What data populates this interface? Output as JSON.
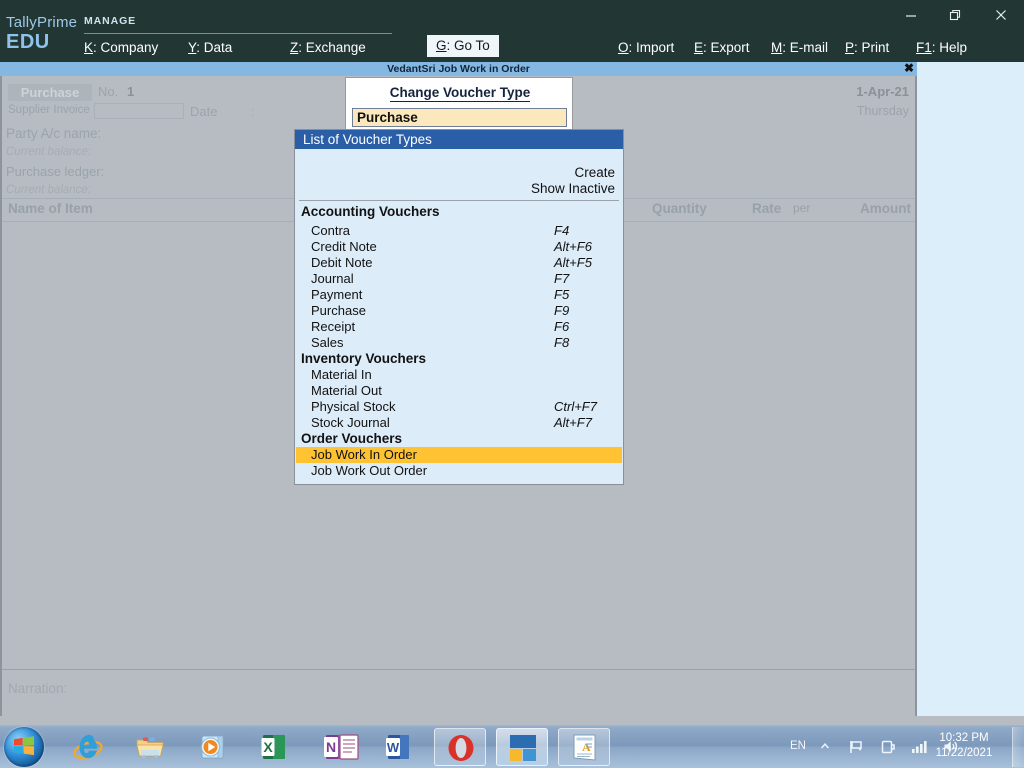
{
  "window": {
    "brand": "TallyPrime",
    "edition": "EDU",
    "minimize_label": "minimize",
    "restore_label": "restore",
    "close_label": "close"
  },
  "topbar": {
    "manage_label": "MANAGE",
    "left_menu": [
      {
        "key": "K",
        "label": "Company"
      },
      {
        "key": "Y",
        "label": "Data"
      },
      {
        "key": "Z",
        "label": "Exchange"
      }
    ],
    "goto": {
      "key": "G",
      "label": "Go To"
    },
    "right_menu": [
      {
        "key": "O",
        "label": "Import"
      },
      {
        "key": "E",
        "label": "Export"
      },
      {
        "key": "M",
        "label": "E-mail"
      },
      {
        "key": "P",
        "label": "Print"
      },
      {
        "key": "F1",
        "label": "Help"
      }
    ]
  },
  "document": {
    "title": "VedantSri Job Work in Order",
    "close_glyph": "✖"
  },
  "voucher_form": {
    "voucher_type": "Purchase",
    "no_label": "No.",
    "no_value": "1",
    "supplier_invoice_label": "Supplier Invoice No.:",
    "supplier_invoice_value": "",
    "date_label": "Date",
    "date_colon": ":",
    "party_label": "Party A/c name:",
    "current_balance_label_1": "Current balance:",
    "purchase_ledger_label": "Purchase ledger:",
    "current_balance_label_2": "Current balance:",
    "header_date": "1-Apr-21",
    "header_day": "Thursday",
    "columns": [
      {
        "label": "Name of Item",
        "align": "left"
      },
      {
        "label": "Quantity",
        "align": "right"
      },
      {
        "label": "Rate",
        "align": "right"
      },
      {
        "label": "per",
        "align": "left"
      },
      {
        "label": "Amount",
        "align": "right"
      }
    ],
    "narration_label": "Narration:"
  },
  "change_voucher_type": {
    "title": "Change Voucher Type",
    "input_value": "Purchase"
  },
  "voucher_list": {
    "header": "List of Voucher Types",
    "actions": [
      "Create",
      "Show Inactive"
    ],
    "groups": [
      {
        "name": "Accounting Vouchers",
        "items": [
          {
            "name": "Contra",
            "shortcut": "F4"
          },
          {
            "name": "Credit Note",
            "shortcut": "Alt+F6"
          },
          {
            "name": "Debit Note",
            "shortcut": "Alt+F5"
          },
          {
            "name": "Journal",
            "shortcut": "F7"
          },
          {
            "name": "Payment",
            "shortcut": "F5"
          },
          {
            "name": "Purchase",
            "shortcut": "F9"
          },
          {
            "name": "Receipt",
            "shortcut": "F6"
          },
          {
            "name": "Sales",
            "shortcut": "F8"
          }
        ]
      },
      {
        "name": "Inventory Vouchers",
        "items": [
          {
            "name": "Material In",
            "shortcut": ""
          },
          {
            "name": "Material Out",
            "shortcut": ""
          },
          {
            "name": "Physical Stock",
            "shortcut": "Ctrl+F7"
          },
          {
            "name": "Stock Journal",
            "shortcut": "Alt+F7"
          }
        ]
      },
      {
        "name": "Order Vouchers",
        "items": [
          {
            "name": "Job Work In Order",
            "shortcut": "",
            "selected": true
          },
          {
            "name": "Job Work Out Order",
            "shortcut": ""
          }
        ]
      }
    ],
    "selected_item": "Job Work In Order"
  },
  "taskbar": {
    "start_label": "Start",
    "pinned": [
      {
        "name": "internet-explorer"
      },
      {
        "name": "file-explorer"
      },
      {
        "name": "windows-media-player"
      },
      {
        "name": "microsoft-excel"
      },
      {
        "name": "microsoft-onenote"
      },
      {
        "name": "notepad-document"
      },
      {
        "name": "microsoft-word"
      }
    ],
    "open_windows": [
      {
        "name": "opera-browser"
      },
      {
        "name": "tallyprime",
        "active": true
      },
      {
        "name": "wordpad-document"
      }
    ],
    "tray": {
      "language": "EN",
      "icons": [
        "show-hidden-icons",
        "action-center-flag",
        "power-plug",
        "network-signal",
        "volume"
      ],
      "time": "10:32 PM",
      "date": "11/22/2021"
    }
  },
  "colors": {
    "topbar_bg": "#223733",
    "accent_blue": "#84b8e3",
    "list_header_blue": "#2a5fa8",
    "selection_amber": "#ffc233",
    "panel_light_blue": "#ddeefb",
    "input_cream": "#fbe8bc",
    "dim_gray": "#b6bcc2"
  }
}
